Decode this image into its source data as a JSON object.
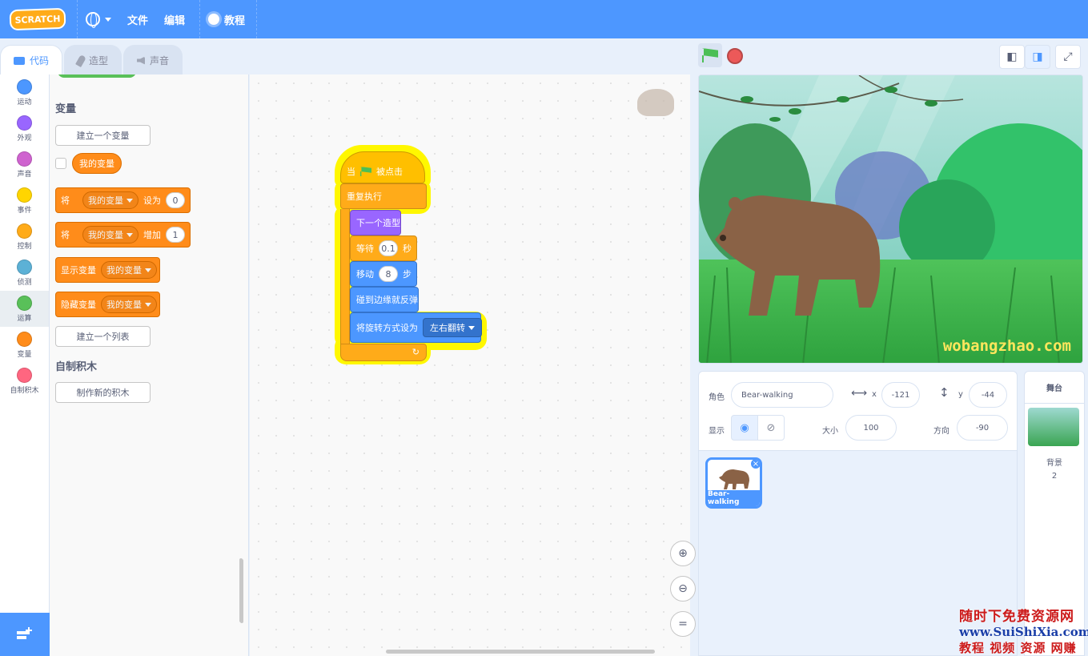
{
  "menubar": {
    "logo": "SCRATCH",
    "file": "文件",
    "edit": "编辑",
    "tutorials": "教程"
  },
  "tabs": {
    "code": "代码",
    "costumes": "造型",
    "sounds": "声音"
  },
  "categories": [
    {
      "label": "运动",
      "color": "#4c97ff"
    },
    {
      "label": "外观",
      "color": "#9966ff"
    },
    {
      "label": "声音",
      "color": "#cf63cf"
    },
    {
      "label": "事件",
      "color": "#ffd500"
    },
    {
      "label": "控制",
      "color": "#ffab19"
    },
    {
      "label": "侦测",
      "color": "#5cb1d6"
    },
    {
      "label": "运算",
      "color": "#59c059"
    },
    {
      "label": "变量",
      "color": "#ff8c1a"
    },
    {
      "label": "自制积木",
      "color": "#ff6680"
    }
  ],
  "palette": {
    "variables_title": "变量",
    "make_variable": "建立一个变量",
    "my_variable": "我的变量",
    "set_block": {
      "prefix": "将",
      "var": "我的变量",
      "op": "设为",
      "value": "0"
    },
    "change_block": {
      "prefix": "将",
      "var": "我的变量",
      "op": "增加",
      "value": "1"
    },
    "show_block": {
      "label": "显示变量",
      "var": "我的变量"
    },
    "hide_block": {
      "label": "隐藏变量",
      "var": "我的变量"
    },
    "make_list": "建立一个列表",
    "my_blocks_title": "自制积木",
    "make_block": "制作新的积木"
  },
  "script": {
    "hat_when": "当",
    "hat_clicked": "被点击",
    "forever": "重复执行",
    "next_costume": "下一个造型",
    "wait_label": "等待",
    "wait_value": "0.1",
    "wait_unit": "秒",
    "move_label": "移动",
    "move_value": "8",
    "move_unit": "步",
    "bounce": "碰到边缘就反弹",
    "rotation_label": "将旋转方式设为",
    "rotation_value": "左右翻转"
  },
  "stage": {
    "watermark": "wobangzhao.com"
  },
  "sprite_info": {
    "sprite_label": "角色",
    "sprite_name": "Bear-walking",
    "x_label": "x",
    "x_value": "-121",
    "y_label": "y",
    "y_value": "-44",
    "show_label": "显示",
    "size_label": "大小",
    "size_value": "100",
    "direction_label": "方向",
    "direction_value": "-90"
  },
  "sprites": [
    {
      "name": "Bear-walking"
    }
  ],
  "stage_pane": {
    "title": "舞台",
    "backdrops_label": "背景",
    "backdrops_count": "2"
  },
  "promo": {
    "line1": "随时下免费资源网",
    "line2": "www.SuiShiXia.com",
    "line3": "教程 视频 资源 网赚"
  }
}
